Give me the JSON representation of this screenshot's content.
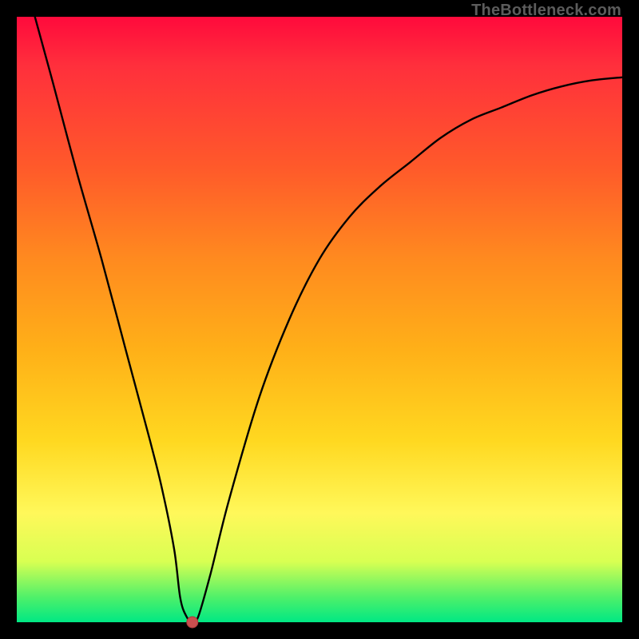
{
  "watermark": "TheBottleneck.com",
  "chart_data": {
    "type": "line",
    "title": "",
    "xlabel": "",
    "ylabel": "",
    "xlim": [
      0,
      100
    ],
    "ylim": [
      0,
      100
    ],
    "series": [
      {
        "name": "bottleneck-curve",
        "x": [
          3,
          6,
          10,
          14,
          18,
          22,
          24,
          26,
          27,
          28,
          29,
          30,
          32,
          35,
          40,
          45,
          50,
          55,
          60,
          65,
          70,
          75,
          80,
          85,
          90,
          95,
          100
        ],
        "y": [
          100,
          89,
          74,
          60,
          45,
          30,
          22,
          12,
          4,
          1,
          0,
          1,
          8,
          20,
          37,
          50,
          60,
          67,
          72,
          76,
          80,
          83,
          85,
          87,
          88.5,
          89.5,
          90
        ]
      }
    ],
    "marker": {
      "x": 29,
      "y": 0,
      "name": "min-point"
    },
    "gradient_stops": [
      {
        "pos": 0,
        "color": "#ff0a3c"
      },
      {
        "pos": 8,
        "color": "#ff2f3c"
      },
      {
        "pos": 25,
        "color": "#ff5a2a"
      },
      {
        "pos": 40,
        "color": "#ff8a1f"
      },
      {
        "pos": 55,
        "color": "#ffb018"
      },
      {
        "pos": 70,
        "color": "#ffd820"
      },
      {
        "pos": 82,
        "color": "#fff85a"
      },
      {
        "pos": 90,
        "color": "#d8ff52"
      },
      {
        "pos": 96,
        "color": "#4cf06a"
      },
      {
        "pos": 100,
        "color": "#00e884"
      }
    ]
  }
}
